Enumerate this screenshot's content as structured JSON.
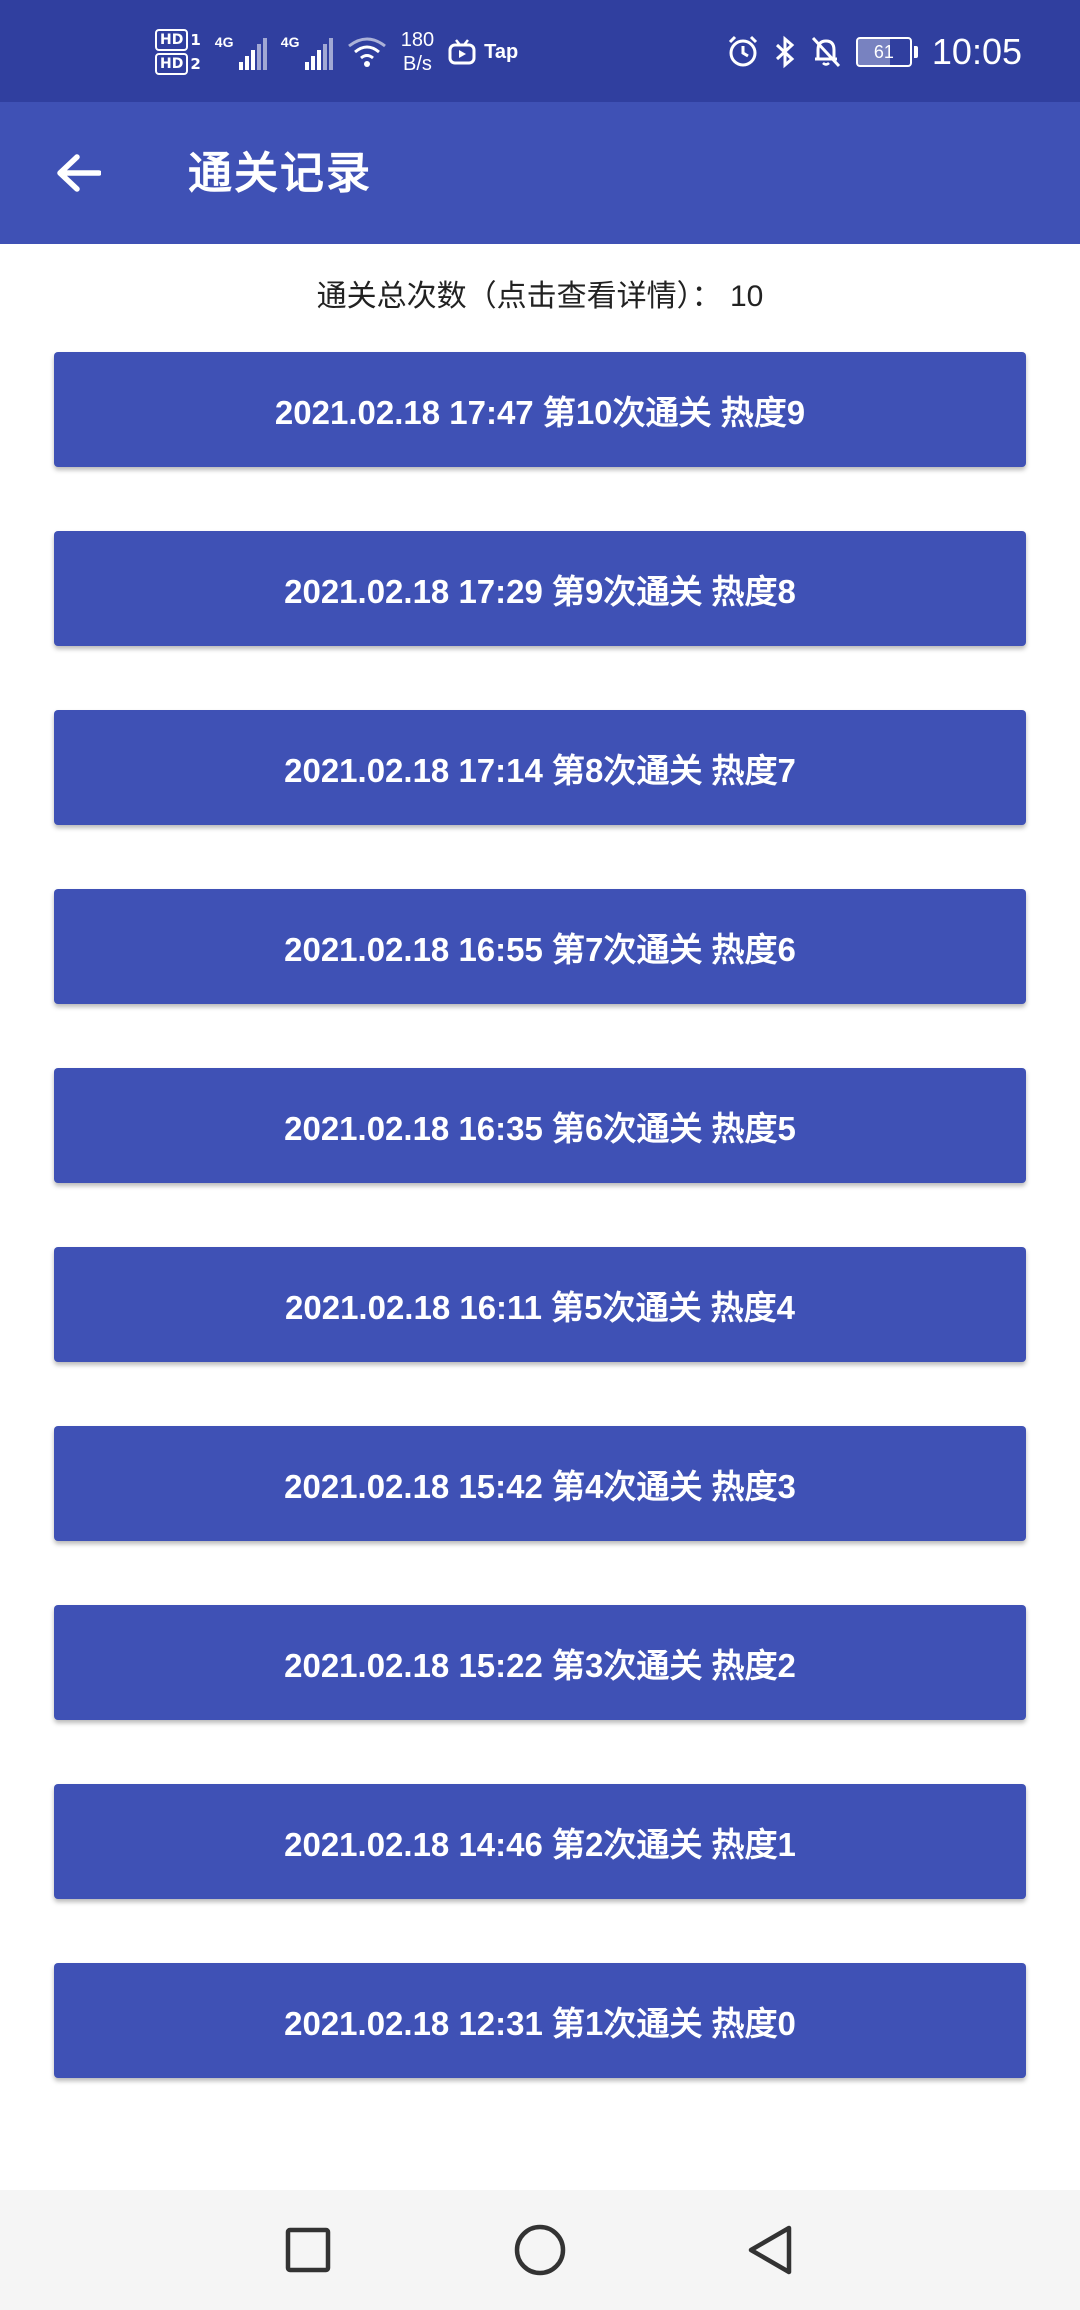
{
  "status_bar": {
    "sim1_label": "HD",
    "sim1_index": "1",
    "sim2_label": "HD",
    "sim2_index": "2",
    "network1": "4G",
    "network2": "4G",
    "speed_value": "180",
    "speed_unit": "B/s",
    "app_indicator": "Tap",
    "battery_level": "61",
    "time": "10:05",
    "icons": [
      "hd-icon",
      "signal-icon",
      "wifi-icon",
      "tv-app-icon",
      "alarm-icon",
      "bluetooth-icon",
      "mute-bell-icon",
      "battery-icon"
    ]
  },
  "app_bar": {
    "title": "通关记录",
    "back_icon": "arrow-left-icon"
  },
  "summary_text": "通关总次数（点击查看详情）：  10",
  "records": [
    {
      "label": "2021.02.18 17:47 第10次通关 热度9"
    },
    {
      "label": "2021.02.18 17:29 第9次通关 热度8"
    },
    {
      "label": "2021.02.18 17:14 第8次通关 热度7"
    },
    {
      "label": "2021.02.18 16:55 第7次通关 热度6"
    },
    {
      "label": "2021.02.18 16:35 第6次通关 热度5"
    },
    {
      "label": "2021.02.18 16:11 第5次通关 热度4"
    },
    {
      "label": "2021.02.18 15:42 第4次通关 热度3"
    },
    {
      "label": "2021.02.18 15:22 第3次通关 热度2"
    },
    {
      "label": "2021.02.18 14:46 第2次通关 热度1"
    },
    {
      "label": "2021.02.18 12:31 第1次通关 热度0"
    }
  ],
  "nav_bar": {
    "icons": [
      "recents-square-icon",
      "home-circle-icon",
      "back-triangle-icon"
    ]
  },
  "colors": {
    "status_bar_bg": "#303f9f",
    "app_bar_bg": "#3f51b5",
    "button_bg": "#3f51b5",
    "button_text": "#ffffff",
    "nav_bar_bg": "#f5f5f5"
  }
}
